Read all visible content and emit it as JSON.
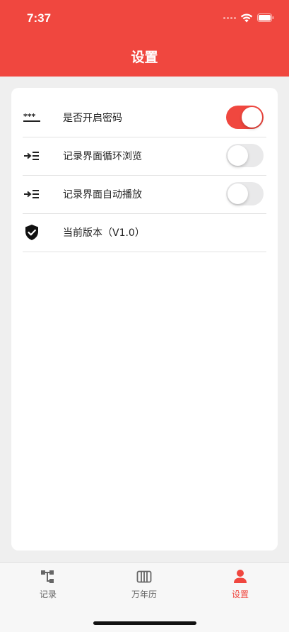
{
  "status_bar": {
    "time": "7:37"
  },
  "nav": {
    "title": "设置"
  },
  "settings": [
    {
      "label": "是否开启密码",
      "icon": "password-icon",
      "has_toggle": true,
      "enabled": true
    },
    {
      "label": "记录界面循环浏览",
      "icon": "indent-icon",
      "has_toggle": true,
      "enabled": false
    },
    {
      "label": "记录界面自动播放",
      "icon": "indent-icon",
      "has_toggle": true,
      "enabled": false
    },
    {
      "label": "当前版本（V1.0）",
      "icon": "shield-check-icon",
      "has_toggle": false
    }
  ],
  "tabbar": {
    "tabs": [
      {
        "label": "记录",
        "icon": "tree-icon",
        "active": false
      },
      {
        "label": "万年历",
        "icon": "calendar-icon",
        "active": false
      },
      {
        "label": "设置",
        "icon": "person-icon",
        "active": true
      }
    ]
  },
  "colors": {
    "accent": "#f0473f",
    "background": "#efefef",
    "card": "#ffffff",
    "toggle_off": "#e9e9ea",
    "tab_inactive": "#666666"
  }
}
